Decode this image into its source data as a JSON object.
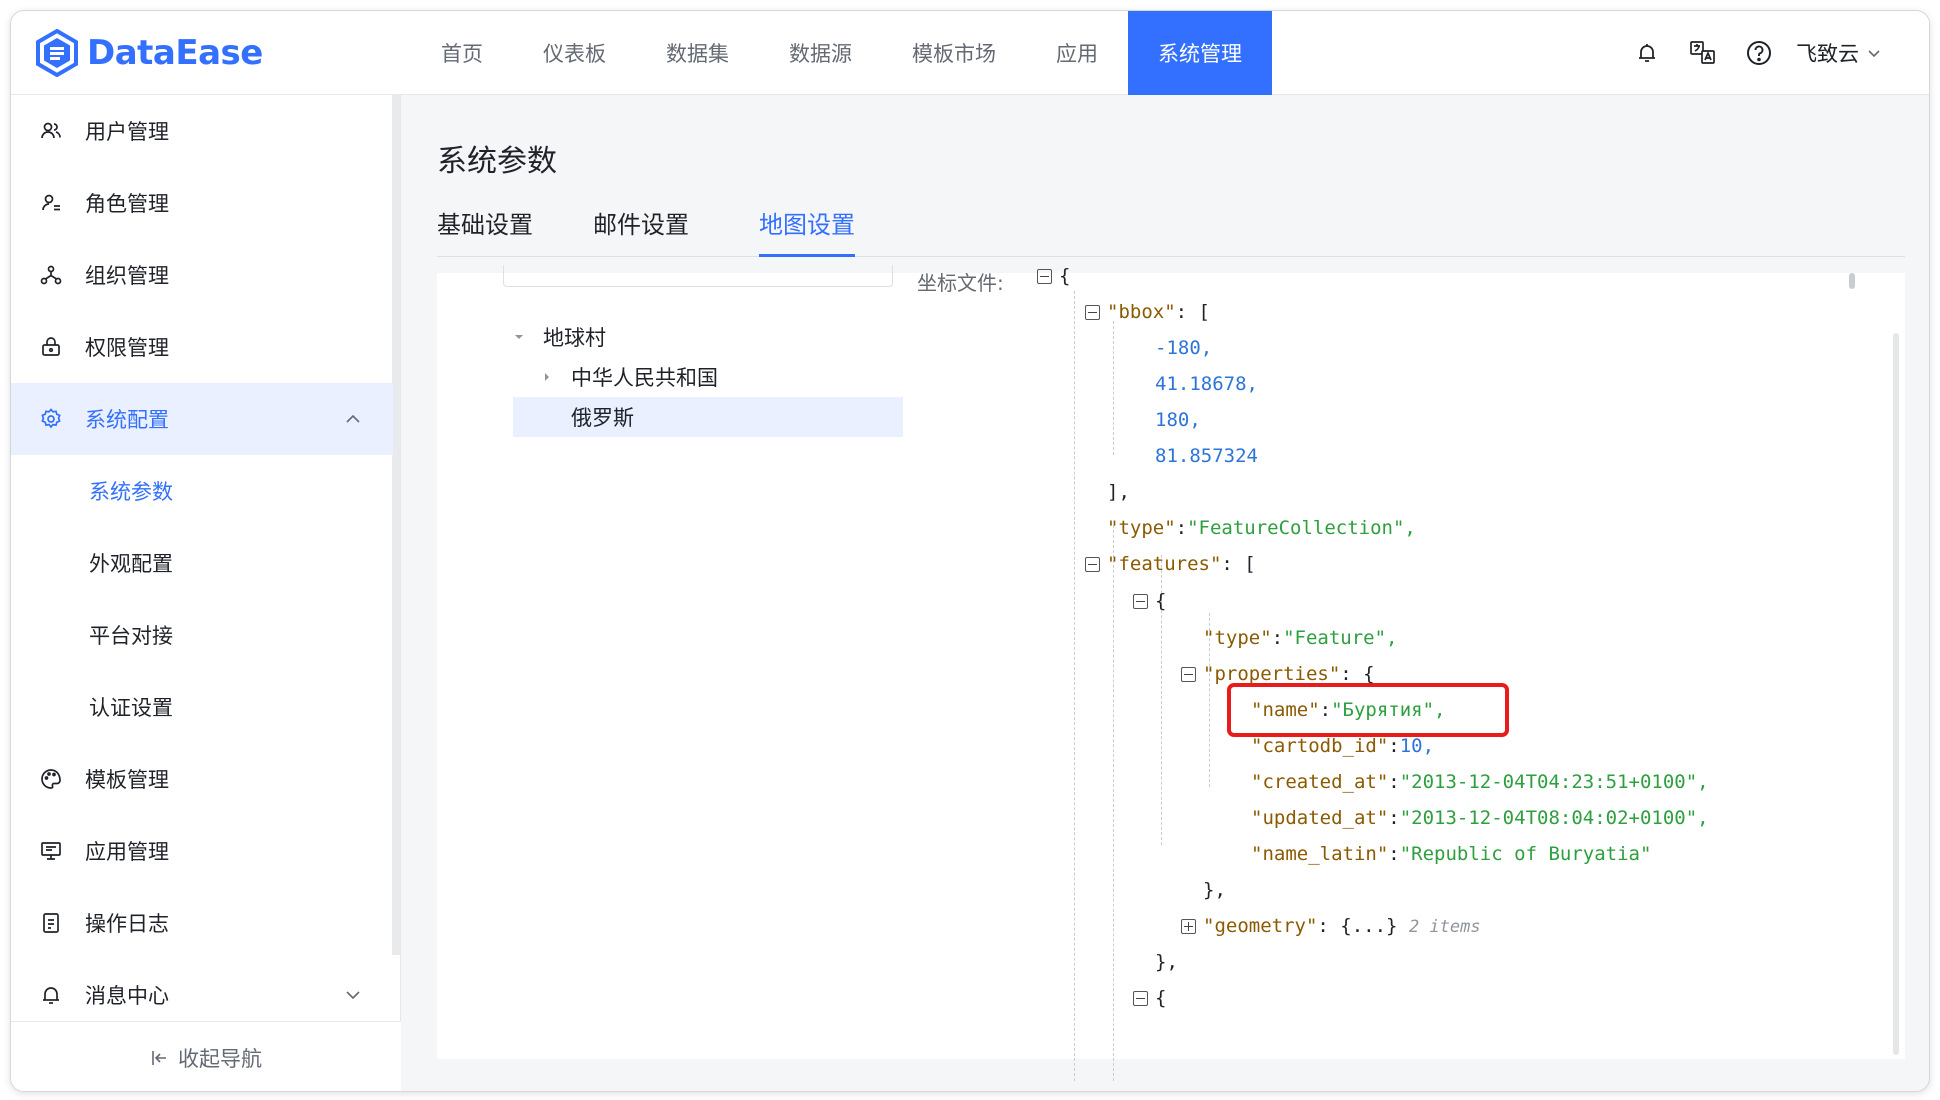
{
  "app": {
    "brand": "DataEase"
  },
  "colors": {
    "accent": "#3370ff",
    "highlight_box": "#e81c1c"
  },
  "nav": {
    "items": [
      "首页",
      "仪表板",
      "数据集",
      "数据源",
      "模板市场",
      "应用",
      "系统管理"
    ],
    "active": "系统管理"
  },
  "header": {
    "user": "飞致云",
    "icons": [
      "bell-icon",
      "translate-icon",
      "help-icon"
    ]
  },
  "sidebar": {
    "items": [
      {
        "label": "用户管理",
        "icon": "user-icon"
      },
      {
        "label": "角色管理",
        "icon": "role-icon"
      },
      {
        "label": "组织管理",
        "icon": "org-icon"
      },
      {
        "label": "权限管理",
        "icon": "lock-icon"
      },
      {
        "label": "系统配置",
        "icon": "gear-icon"
      },
      {
        "label": "模板管理",
        "icon": "palette-icon"
      },
      {
        "label": "应用管理",
        "icon": "monitor-icon"
      },
      {
        "label": "操作日志",
        "icon": "log-icon"
      },
      {
        "label": "消息中心",
        "icon": "bell-icon"
      }
    ],
    "sub_items": [
      "系统参数",
      "外观配置",
      "平台对接",
      "认证设置"
    ],
    "active_sub": "系统参数",
    "collapse_label": "收起导航"
  },
  "page": {
    "title": "系统参数",
    "tabs": [
      "基础设置",
      "邮件设置",
      "地图设置"
    ],
    "active_tab": "地图设置"
  },
  "tree": {
    "nodes": [
      "地球村",
      "中华人民共和国",
      "俄罗斯"
    ],
    "selected": "俄罗斯"
  },
  "json_viewer": {
    "label": "坐标文件:",
    "bbox_key": "\"bbox\"",
    "bbox_values": [
      "-180,",
      "41.18678,",
      "180,",
      "81.857324"
    ],
    "type_key": "\"type\"",
    "type_value": "\"FeatureCollection\",",
    "features_key": "\"features\"",
    "feature_type_value": "\"Feature\",",
    "properties_key": "\"properties\"",
    "props": [
      {
        "key": "\"name\"",
        "value": "\"Бурятия\",",
        "kind": "string"
      },
      {
        "key": "\"cartodb_id\"",
        "value": "10,",
        "kind": "number"
      },
      {
        "key": "\"created_at\"",
        "value": "\"2013-12-04T04:23:51+0100\",",
        "kind": "string"
      },
      {
        "key": "\"updated_at\"",
        "value": "\"2013-12-04T08:04:02+0100\",",
        "kind": "string"
      },
      {
        "key": "\"name_latin\"",
        "value": "\"Republic of Buryatia\"",
        "kind": "string"
      }
    ],
    "geometry_key": "\"geometry\"",
    "geometry_collapsed": "{...}",
    "geometry_hint": "2 items"
  }
}
